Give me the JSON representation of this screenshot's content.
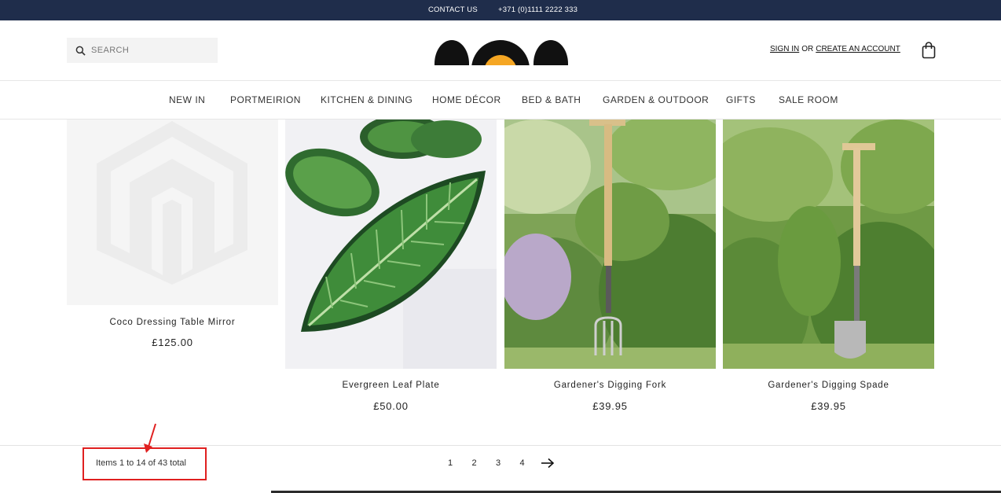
{
  "topbar": {
    "contact_label": "CONTACT US",
    "phone": "+371 (0)1111 2222 333"
  },
  "header": {
    "search_placeholder": "SEARCH",
    "sign_in": "SIGN IN",
    "or": "OR",
    "create_account": "CREATE AN ACCOUNT"
  },
  "nav": {
    "items": [
      {
        "label": "NEW IN"
      },
      {
        "label": "PORTMEIRION"
      },
      {
        "label": "KITCHEN & DINING"
      },
      {
        "label": "HOME DÉCOR"
      },
      {
        "label": "BED & BATH"
      },
      {
        "label": "GARDEN & OUTDOOR"
      },
      {
        "label": "GIFTS"
      },
      {
        "label": "SALE ROOM"
      }
    ]
  },
  "products": [
    {
      "name": "Coco Dressing Table Mirror",
      "price": "£125.00"
    },
    {
      "name": "Evergreen Leaf Plate",
      "price": "£50.00"
    },
    {
      "name": "Gardener's Digging Fork",
      "price": "£39.95"
    },
    {
      "name": "Gardener's Digging Spade",
      "price": "£39.95"
    }
  ],
  "toolbar": {
    "amount_text": "Items 1 to 14 of 43 total",
    "pages": [
      "1",
      "2",
      "3",
      "4"
    ],
    "next_icon": "arrow-right-icon"
  },
  "colors": {
    "topbar_bg": "#1f2d4b",
    "highlight_border": "#e02020",
    "logo_orange": "#f5a623"
  }
}
